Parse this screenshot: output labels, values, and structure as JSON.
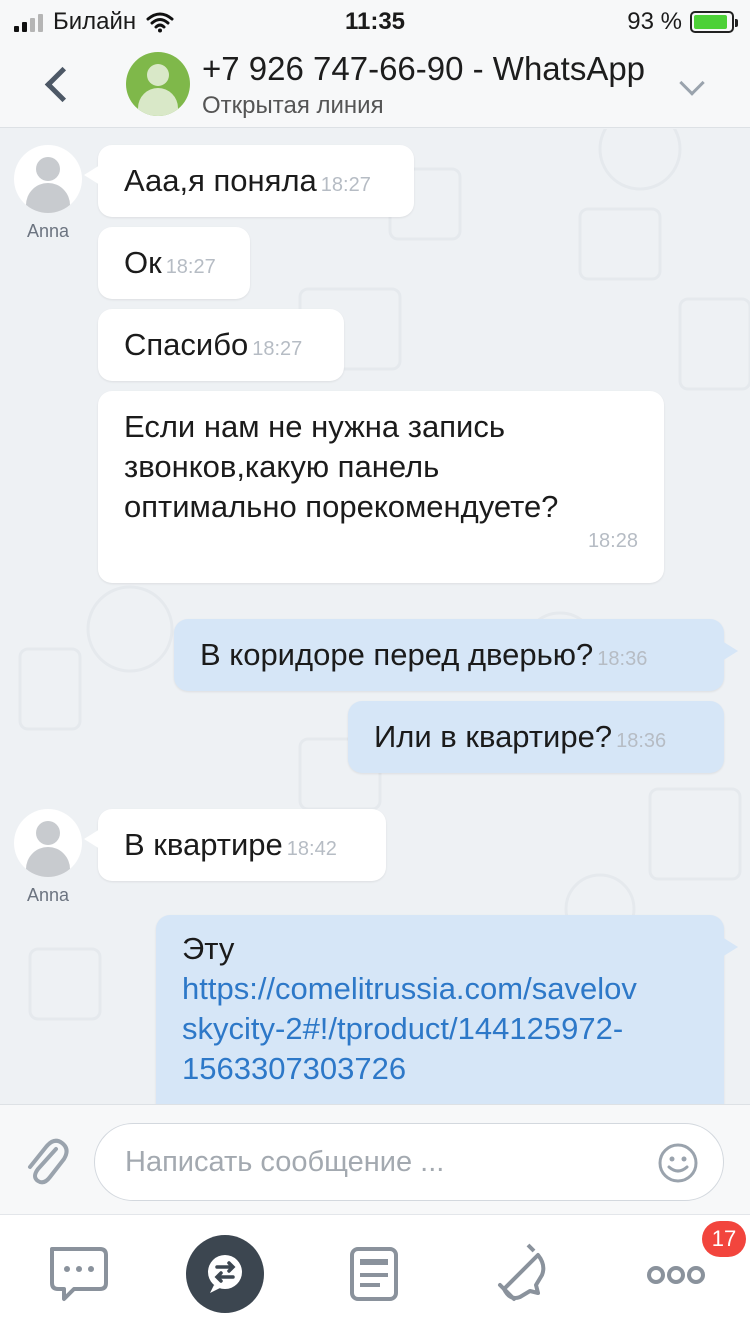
{
  "status_bar": {
    "carrier": "Билайн",
    "time": "11:35",
    "battery_percent": "93 %",
    "battery_level": 0.93
  },
  "header": {
    "title": "+7 926 747-66-90 - WhatsApp",
    "subtitle": "Открытая линия"
  },
  "messages": [
    {
      "direction": "in",
      "sender": "Anna",
      "text": "Ааа,я поняла",
      "time": "18:27"
    },
    {
      "direction": "in",
      "text": "Ок",
      "time": "18:27"
    },
    {
      "direction": "in",
      "text": "Спасибо",
      "time": "18:27"
    },
    {
      "direction": "in",
      "lines": [
        "Если нам не нужна запись",
        "звонков,какую панель",
        "оптимально порекомендуете?"
      ],
      "time": "18:28"
    },
    {
      "direction": "out",
      "text": "В коридоре перед дверью?",
      "time": "18:36"
    },
    {
      "direction": "out",
      "text": "Или в квартире?",
      "time": "18:36"
    },
    {
      "direction": "in",
      "sender": "Anna",
      "text": "В квартире",
      "time": "18:42"
    },
    {
      "direction": "out",
      "text": "Эту",
      "link_lines": [
        "https://comelitrussia.com/savelov",
        "skycity-2#!/tproduct/144125972-",
        "1563307303726"
      ]
    }
  ],
  "composer": {
    "placeholder": "Написать сообщение ..."
  },
  "tabbar": {
    "badge_count": "17"
  },
  "icons": {
    "back": "chevron-left-icon",
    "header_menu": "chevron-down-icon",
    "attach": "paperclip-icon",
    "emoji": "smile-icon",
    "tabs": [
      "chat-bubble-icon",
      "open-lines-icon",
      "feed-icon",
      "bell-icon",
      "more-icon"
    ]
  },
  "colors": {
    "incoming_bubble": "#ffffff",
    "outgoing_bubble": "#d6e6f7",
    "link": "#2d78c8",
    "badge": "#f2453d",
    "header_avatar": "#7fb84a"
  }
}
